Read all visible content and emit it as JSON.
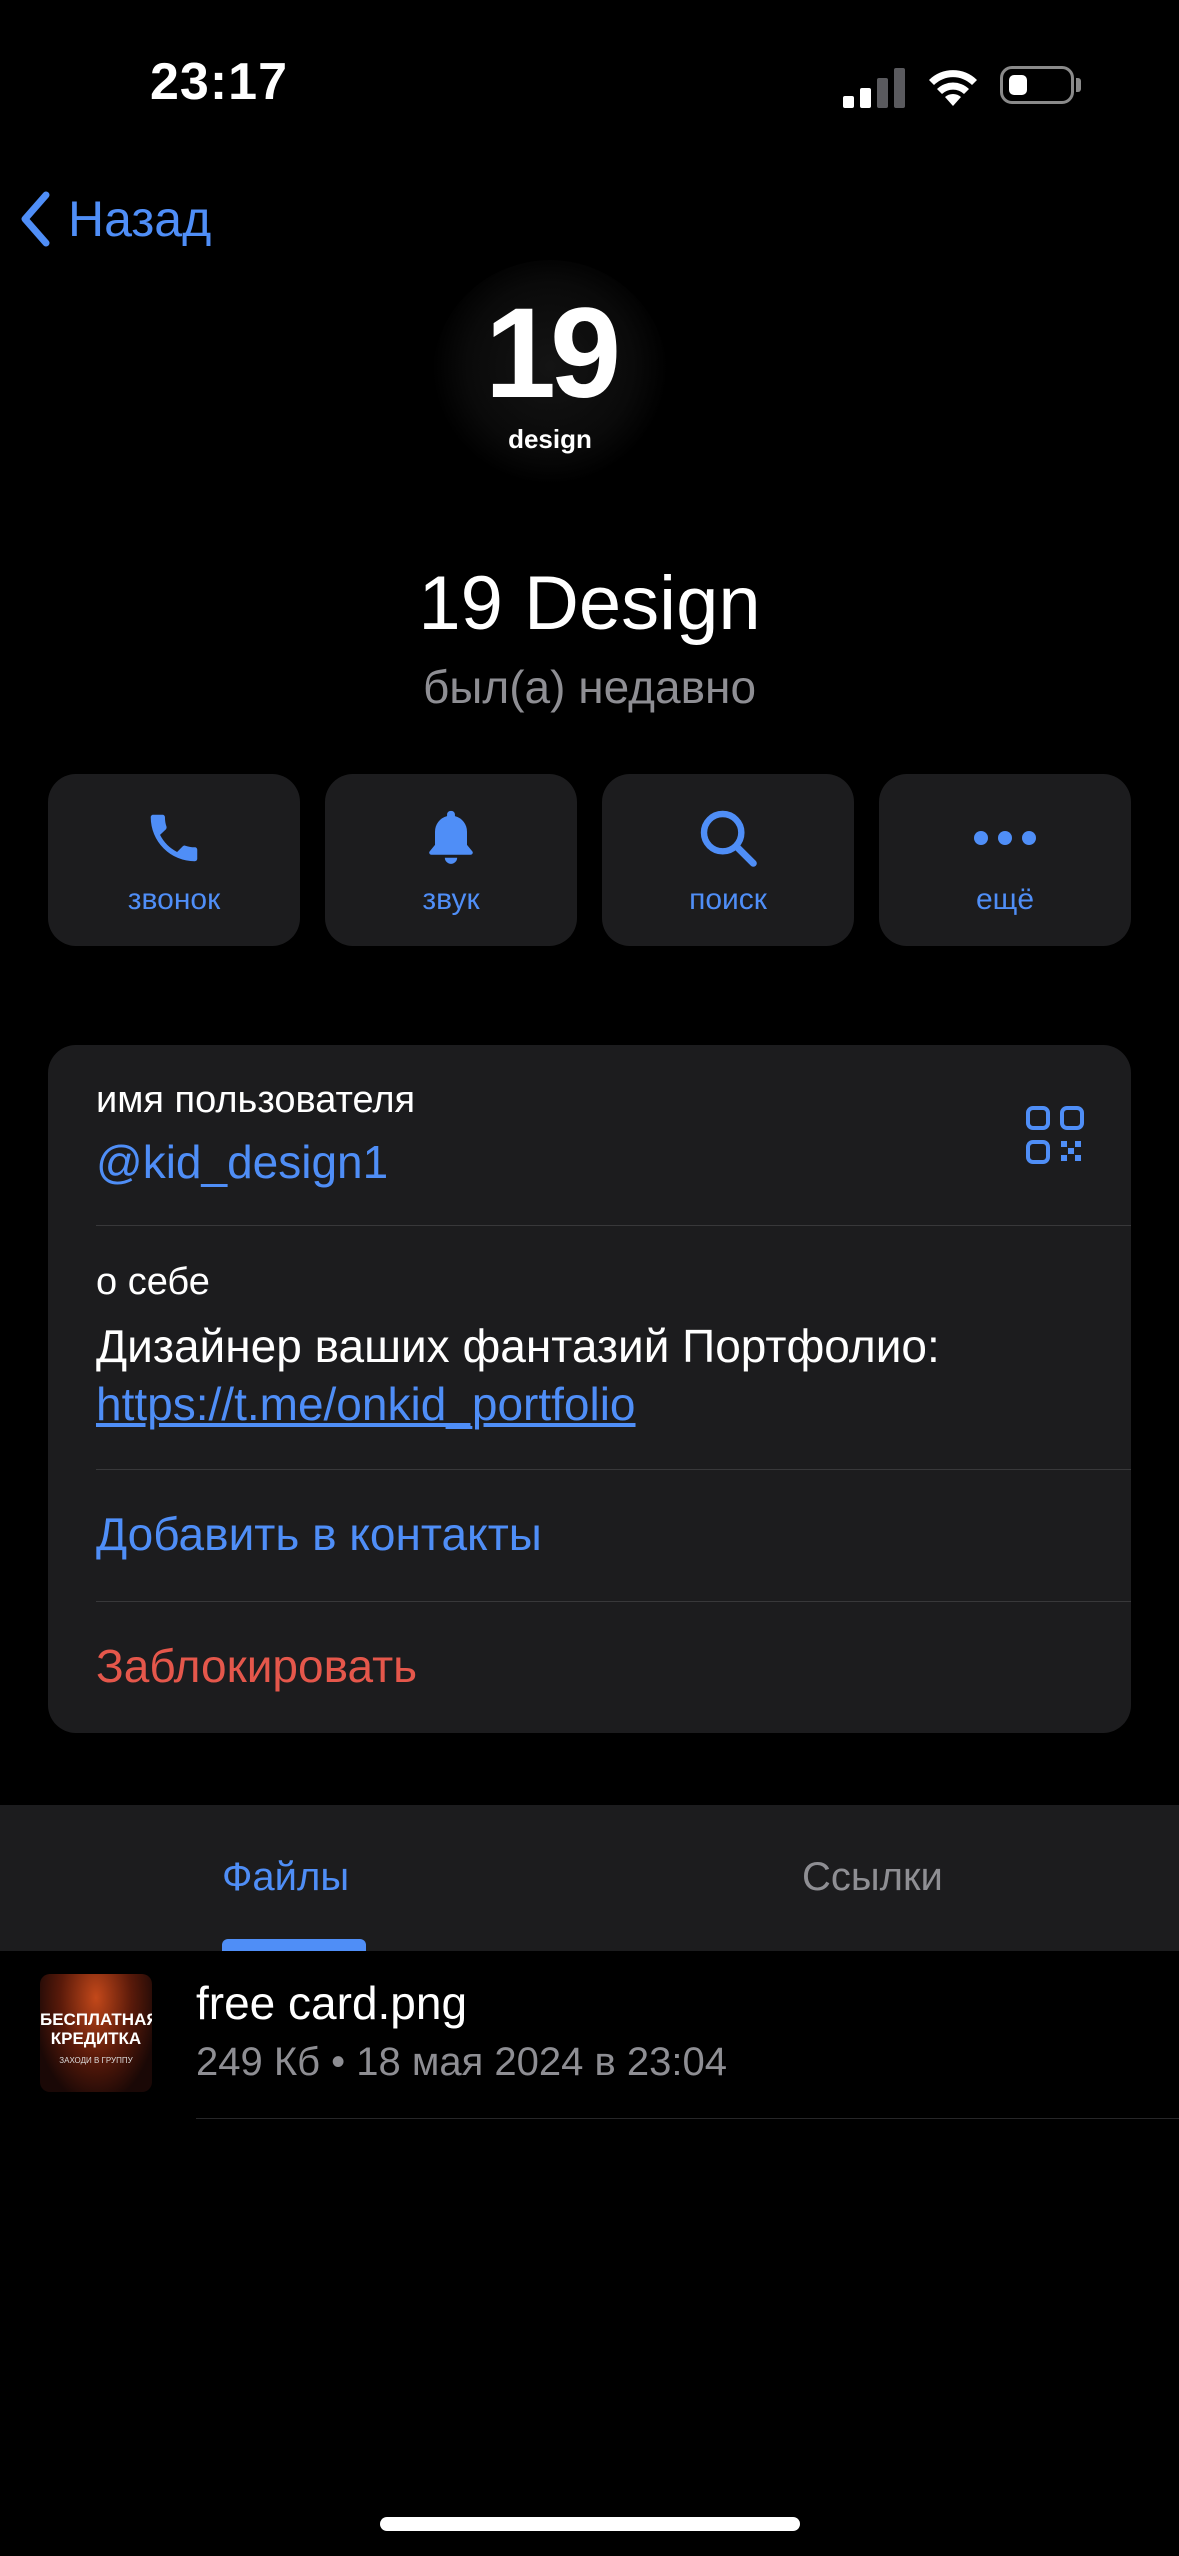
{
  "status_bar": {
    "time": "23:17"
  },
  "nav": {
    "back_label": "Назад"
  },
  "profile": {
    "avatar_number": "19",
    "avatar_word": "design",
    "name": "19 Design",
    "status": "был(а) недавно"
  },
  "actions": [
    {
      "label": "звонок",
      "icon": "phone-icon"
    },
    {
      "label": "звук",
      "icon": "bell-icon"
    },
    {
      "label": "поиск",
      "icon": "search-icon"
    },
    {
      "label": "ещё",
      "icon": "more-icon"
    }
  ],
  "info": {
    "username_label": "имя пользователя",
    "username": "@kid_design1",
    "about_label": "о себе",
    "about_text": "Дизайнер ваших фантазий Портфолио:",
    "about_link": "https://t.me/onkid_portfolio",
    "add_contact": "Добавить в контакты",
    "block": "Заблокировать"
  },
  "tabs": [
    {
      "label": "Файлы",
      "active": true
    },
    {
      "label": "Ссылки",
      "active": false
    }
  ],
  "files": [
    {
      "name": "free card.png",
      "meta": "249 Кб • 18 мая 2024 в 23:04",
      "thumb_title": "БЕСПЛАТНАЯ КРЕДИТКА",
      "thumb_sub": "ЗАХОДИ В ГРУППУ"
    }
  ],
  "colors": {
    "accent": "#4f8ef7",
    "danger": "#e5574b",
    "card": "#1c1c1e",
    "secondary": "#8e8e93"
  }
}
